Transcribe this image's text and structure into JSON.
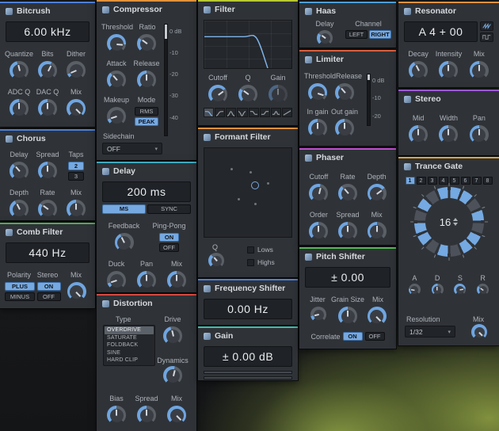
{
  "colors": {
    "accent": "#74a9e2",
    "ring_off": "#4d525a",
    "bitcrush": "#4d7fd8",
    "chorus": "#4d7fd8",
    "comb_filter": "#56a854",
    "compressor": "#e0923c",
    "delay": "#3fa9bf",
    "distortion": "#d9493f",
    "filter": "#b9c832",
    "formant_filter": "#e0923c",
    "frequency_shifter": "#4d7fd8",
    "gain": "#3fbfae",
    "haas": "#4d9fd8",
    "limiter": "#d95f3f",
    "phaser": "#c04fd0",
    "pitch_shifter": "#54b954",
    "resonator": "#e0923c",
    "stereo": "#9c59d6",
    "trance_gate": "#e0a33c"
  },
  "bitcrush": {
    "title": "Bitcrush",
    "display": "6.00 kHz",
    "row1": [
      "Quantize",
      "Bits",
      "Dither"
    ],
    "row2": [
      "ADC Q",
      "DAC Q",
      "Mix"
    ],
    "knobs": {
      "quantize": 0.45,
      "bits": 0.6,
      "dither": 0.08,
      "adc_q": 0.5,
      "dac_q": 0.5,
      "mix": 1
    }
  },
  "chorus": {
    "title": "Chorus",
    "row1": [
      "Delay",
      "Spread",
      "Taps"
    ],
    "row2": [
      "Depth",
      "Rate",
      "Mix"
    ],
    "taps_options": [
      "2",
      "3"
    ],
    "taps_selected": "2",
    "knobs": {
      "delay": 0.35,
      "spread": 0.5,
      "depth": 0.4,
      "rate": 0.3,
      "mix": 0.5
    }
  },
  "comb_filter": {
    "title": "Comb Filter",
    "display": "440 Hz",
    "labels": [
      "Polarity",
      "Stereo",
      "Mix"
    ],
    "polarity_options": [
      "PLUS",
      "MINUS"
    ],
    "polarity_selected": "PLUS",
    "stereo_options": [
      "ON",
      "OFF"
    ],
    "stereo_selected": "ON",
    "knobs": {
      "mix": 1
    }
  },
  "compressor": {
    "title": "Compressor",
    "row1": [
      "Threshold",
      "Ratio"
    ],
    "row2": [
      "Attack",
      "Release"
    ],
    "row3": [
      "Makeup",
      "Mode"
    ],
    "mode_options": [
      "RMS",
      "PEAK"
    ],
    "mode_selected": "PEAK",
    "sidechain_label": "Sidechain",
    "sidechain_value": "OFF",
    "meter_scale": [
      "0 dB",
      "-10",
      "-20",
      "-30",
      "-40"
    ],
    "knobs": {
      "threshold": 0.85,
      "ratio": 0.3,
      "attack": 0.35,
      "release": 0.5,
      "makeup": 0.1
    }
  },
  "delay": {
    "title": "Delay",
    "display": "200 ms",
    "time_modes": [
      "MS",
      "SYNC"
    ],
    "time_mode_selected": "MS",
    "row1": [
      "Feedback",
      "Ping-Pong"
    ],
    "pingpong_options": [
      "ON",
      "OFF"
    ],
    "pingpong_selected": "ON",
    "row2": [
      "Duck",
      "Pan",
      "Mix"
    ],
    "knobs": {
      "feedback": 0.4,
      "duck": 0.1,
      "pan": 0.5,
      "mix": 0.5
    }
  },
  "distortion": {
    "title": "Distortion",
    "type_label": "Type",
    "drive_label": "Drive",
    "dynamics_label": "Dynamics",
    "types": [
      "OVERDRIVE",
      "SATURATE",
      "FOLDBACK",
      "SINE",
      "HARD CLIP"
    ],
    "selected_type": "OVERDRIVE",
    "row": [
      "Bias",
      "Spread",
      "Mix"
    ],
    "knobs": {
      "drive": 0.45,
      "dynamics": 0.55,
      "bias": 0.5,
      "spread": 0.5,
      "mix": 1
    }
  },
  "filter": {
    "title": "Filter",
    "row": [
      "Cutoff",
      "Q",
      "Gain"
    ],
    "shapes": [
      "lowpass",
      "highpass",
      "bandpass",
      "notch",
      "low-shelf",
      "high-shelf",
      "peak",
      "allpass"
    ],
    "shape_selected": "lowpass",
    "knobs": {
      "cutoff": 0.7,
      "q": 0.3,
      "gain": 0.5
    }
  },
  "formant_filter": {
    "title": "Formant Filter",
    "q_label": "Q",
    "checkboxes": [
      "Lows",
      "Highs"
    ],
    "knobs": {
      "q": 0.35
    }
  },
  "frequency_shifter": {
    "title": "Frequency Shifter",
    "display": "0.00 Hz"
  },
  "gain": {
    "title": "Gain",
    "display": "± 0.00 dB"
  },
  "haas": {
    "title": "Haas",
    "delay_label": "Delay",
    "channel_label": "Channel",
    "channel_options": [
      "LEFT",
      "RIGHT"
    ],
    "channel_selected": "RIGHT",
    "knobs": {
      "delay": 0.3
    }
  },
  "limiter": {
    "title": "Limiter",
    "row1": [
      "Threshold",
      "Release"
    ],
    "row2": [
      "In gain",
      "Out gain"
    ],
    "meter_scale": [
      "0 dB",
      "-10",
      "-20"
    ],
    "knobs": {
      "threshold": 0.9,
      "release": 0.35,
      "in_gain": 0.5,
      "out_gain": 0.5
    }
  },
  "phaser": {
    "title": "Phaser",
    "row1": [
      "Cutoff",
      "Rate",
      "Depth"
    ],
    "row2": [
      "Order",
      "Spread",
      "Mix"
    ],
    "knobs": {
      "cutoff": 0.55,
      "rate": 0.35,
      "depth": 0.7,
      "order": 0.5,
      "spread": 0.5,
      "mix": 0.5
    }
  },
  "pitch_shifter": {
    "title": "Pitch Shifter",
    "display": "± 0.00",
    "row": [
      "Jitter",
      "Grain Size",
      "Mix"
    ],
    "correlate_label": "Correlate",
    "correlate_options": [
      "ON",
      "OFF"
    ],
    "correlate_selected": "ON",
    "knobs": {
      "jitter": 0.12,
      "grain_size": 0.5,
      "mix": 1
    }
  },
  "resonator": {
    "title": "Resonator",
    "display": "A 4 + 00",
    "row": [
      "Decay",
      "Intensity",
      "Mix"
    ],
    "knobs": {
      "decay": 0.4,
      "intensity": 0.5,
      "mix": 0.5
    }
  },
  "stereo": {
    "title": "Stereo",
    "row": [
      "Mid",
      "Width",
      "Pan"
    ],
    "knobs": {
      "mid": 0.5,
      "width": 0.5,
      "pan": 0.5
    }
  },
  "trance_gate": {
    "title": "Trance Gate",
    "patterns": [
      "1",
      "2",
      "3",
      "4",
      "5",
      "6",
      "7",
      "8"
    ],
    "selected_pattern": "1",
    "steps": [
      1,
      1,
      0,
      1,
      0,
      1,
      1,
      0,
      1,
      0,
      1,
      1,
      0,
      1,
      0,
      1
    ],
    "length_value": "16",
    "env_labels": [
      "A",
      "D",
      "S",
      "R"
    ],
    "resolution_label": "Resolution",
    "resolution_value": "1/32",
    "mix_label": "Mix",
    "knobs": {
      "a": 0.2,
      "d": 0.5,
      "s": 0.8,
      "r": 0.3,
      "mix": 1
    }
  }
}
